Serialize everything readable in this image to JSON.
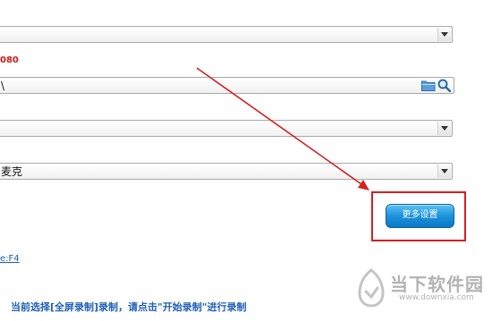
{
  "form": {
    "resolution_hint": "080",
    "path_value": "\\",
    "select_1_value": "",
    "select_2_value": "",
    "select_3_value": "麦克",
    "more_settings_label": "更多设置",
    "hotkey_link": "e:F4"
  },
  "status": {
    "message": "当前选择[全屏录制]录制，请点击\"开始录制\"进行录制"
  },
  "watermark": {
    "title": "当下软件园",
    "url": "www.downxia.com"
  },
  "colors": {
    "annotation_red": "#d42020",
    "button_blue": "#1d93da",
    "status_blue": "#2060b8"
  },
  "icons": [
    "folder-icon",
    "search-icon",
    "chevron-down-icon"
  ]
}
